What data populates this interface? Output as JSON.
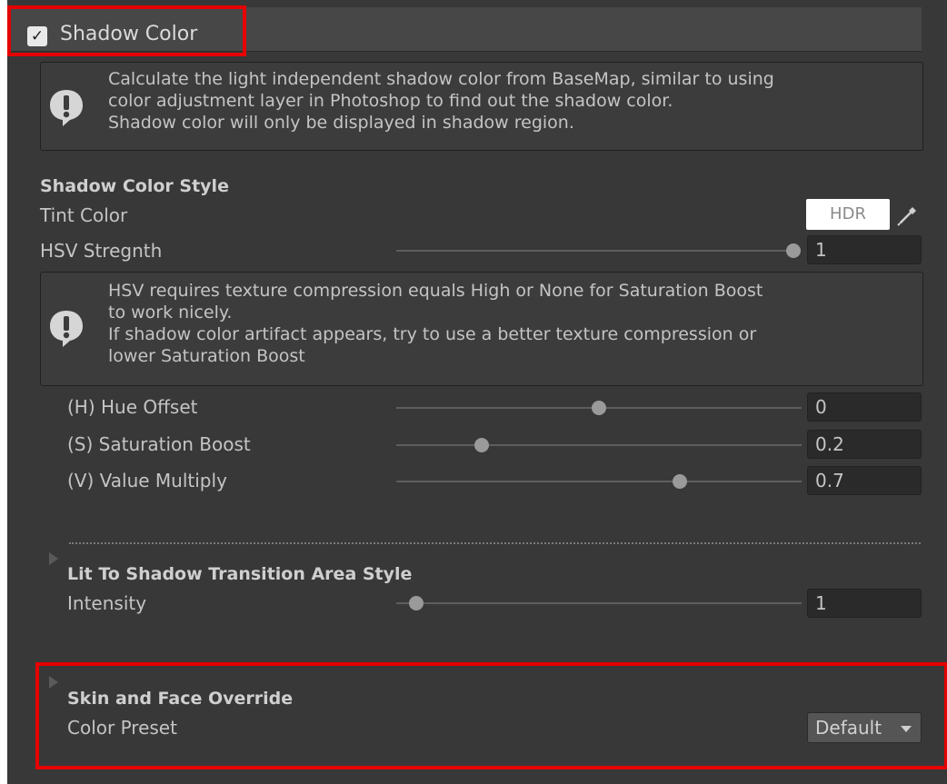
{
  "header": {
    "title": "Shadow Color",
    "checked": true
  },
  "help_boxes": [
    {
      "lines": [
        "Calculate the light independent shadow color from BaseMap, similar to using",
        "color adjustment layer in Photoshop to find out the shadow color.",
        "Shadow color will only be displayed in shadow region."
      ]
    },
    {
      "lines": [
        "HSV requires texture compression equals High or None for Saturation Boost",
        "to work nicely.",
        "If shadow color artifact appears, try to use a better texture compression or",
        "lower Saturation Boost"
      ]
    }
  ],
  "shadow_color_style": {
    "title": "Shadow Color Style",
    "tint_color": {
      "label": "Tint Color",
      "swatch_text": "HDR",
      "swatch_color": "#ffffff"
    },
    "hsv_strength": {
      "label": "HSV Stregnth",
      "value": "1",
      "fraction": 1.0
    },
    "hue_offset": {
      "label": "(H) Hue Offset",
      "value": "0",
      "fraction": 0.5
    },
    "saturation_boost": {
      "label": "(S) Saturation Boost",
      "value": "0.2",
      "fraction": 0.21
    },
    "value_multiply": {
      "label": "(V) Value Multiply",
      "value": "0.7",
      "fraction": 0.7
    }
  },
  "transition": {
    "title": "Lit To Shadow Transition Area Style",
    "intensity": {
      "label": "Intensity",
      "value": "1",
      "fraction": 0.05
    }
  },
  "skin_face": {
    "title": "Skin and Face Override",
    "color_preset": {
      "label": "Color Preset",
      "value": "Default"
    }
  },
  "colors": {
    "highlight": "#e60000",
    "panel_bg": "#383838"
  }
}
